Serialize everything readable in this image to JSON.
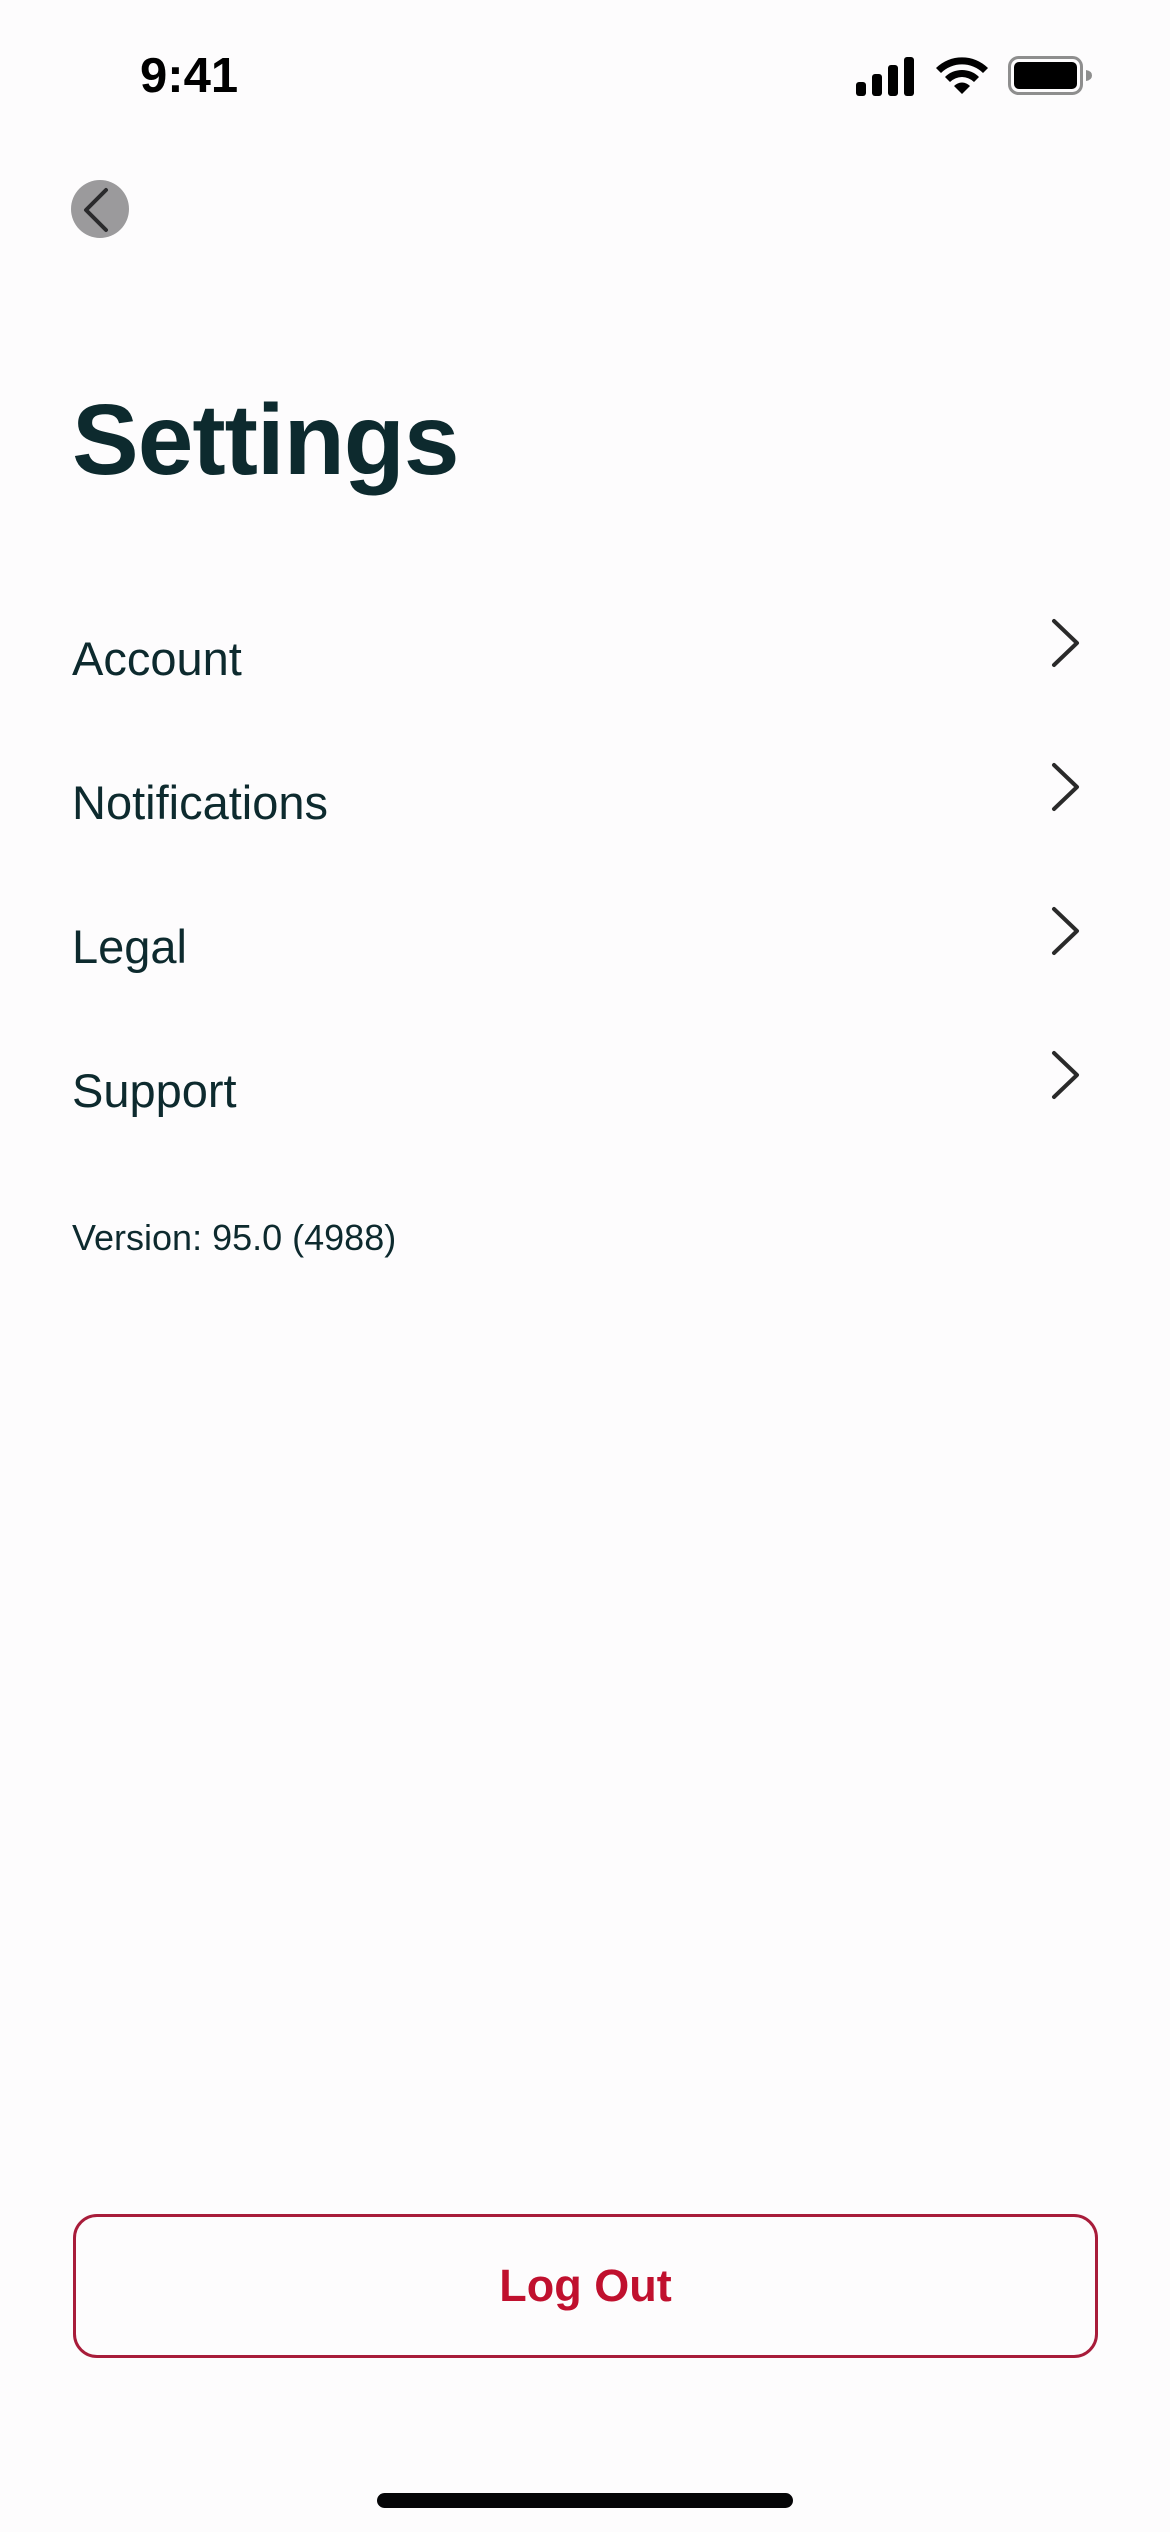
{
  "status_bar": {
    "time": "9:41",
    "icons": [
      "cellular-signal-icon",
      "wifi-icon",
      "battery-icon"
    ]
  },
  "navigation": {
    "back_icon": "chevron-left-icon"
  },
  "header": {
    "title": "Settings"
  },
  "settings": {
    "items": [
      {
        "label": "Account",
        "icon": "chevron-right-icon"
      },
      {
        "label": "Notifications",
        "icon": "chevron-right-icon"
      },
      {
        "label": "Legal",
        "icon": "chevron-right-icon"
      },
      {
        "label": "Support",
        "icon": "chevron-right-icon"
      }
    ]
  },
  "footer": {
    "version": "Version: 95.0 (4988)",
    "logout_label": "Log Out"
  },
  "colors": {
    "background": "#fdfcfd",
    "text_primary": "#0d2a2e",
    "chevron": "#2a2a2a",
    "back_button_bg": "#9b9a9c",
    "logout_border": "#a81c3a",
    "logout_text": "#c0102e"
  }
}
